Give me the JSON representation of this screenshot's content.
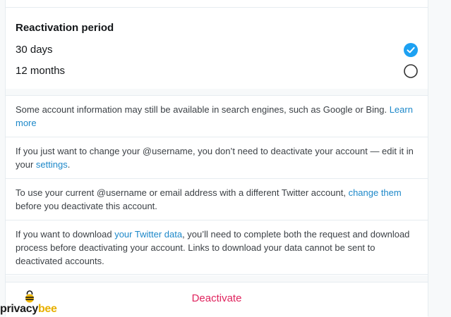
{
  "reactivation": {
    "title": "Reactivation period",
    "options": [
      {
        "label": "30 days",
        "selected": true
      },
      {
        "label": "12 months",
        "selected": false
      }
    ]
  },
  "info": {
    "search_engines": {
      "text": "Some account information may still be available in search engines, such as Google or Bing.",
      "link": "Learn more"
    },
    "username": {
      "text_before": "If you just want to change your @username, you don’t need to deactivate your account — edit it in your ",
      "link": "settings",
      "text_after": "."
    },
    "other_account": {
      "text_before": "To use your current @username or email address with a different Twitter account, ",
      "link": "change them",
      "text_after": " before you deactivate this account."
    },
    "download": {
      "text_before": "If you want to download ",
      "link": "your Twitter data",
      "text_after": ", you’ll need to complete both the request and download process before deactivating your account. Links to download your data cannot be sent to deactivated accounts."
    }
  },
  "deactivate_label": "Deactivate",
  "watermark": {
    "part1": "privacy",
    "part2": "bee"
  },
  "colors": {
    "accent": "#1da1f2",
    "link": "#1d88c9",
    "danger": "#e0245e",
    "border": "#e6ecf0"
  },
  "icons": {
    "selected": "check-circle-icon",
    "unselected": "radio-empty-icon",
    "logo": "bee-icon"
  }
}
